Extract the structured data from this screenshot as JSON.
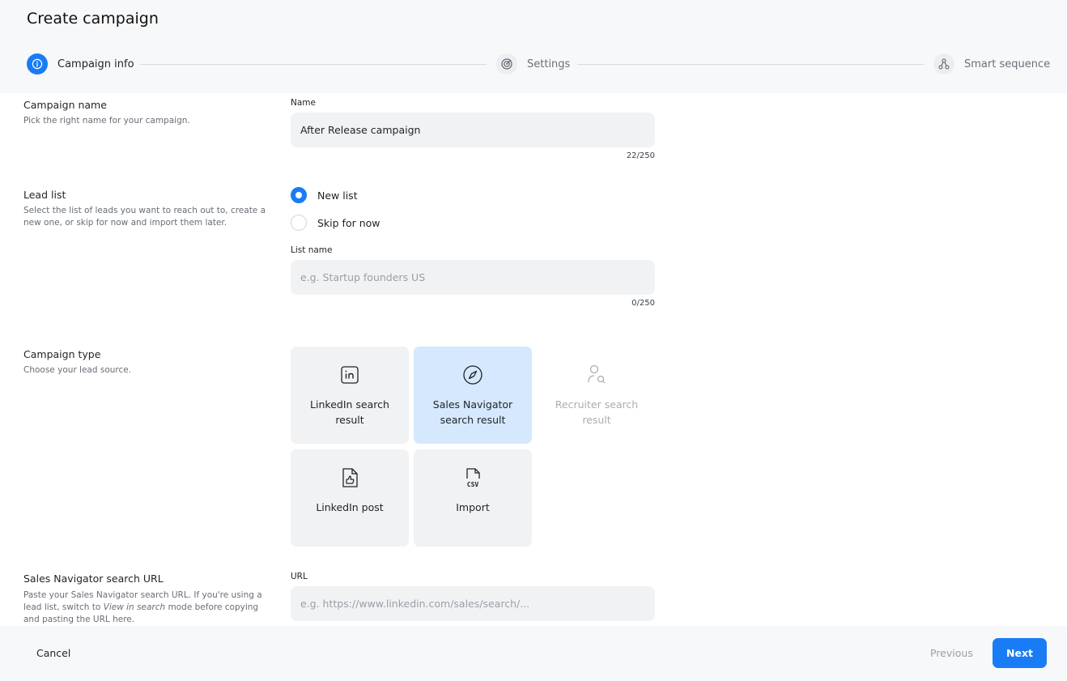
{
  "page": {
    "title": "Create campaign"
  },
  "stepper": {
    "steps": [
      {
        "label": "Campaign info",
        "state": "active",
        "icon": "info-icon"
      },
      {
        "label": "Settings",
        "state": "inactive",
        "icon": "target-icon"
      },
      {
        "label": "Smart sequence",
        "state": "inactive",
        "icon": "sequence-icon"
      }
    ]
  },
  "campaign_name": {
    "title": "Campaign name",
    "description": "Pick the right name for your campaign.",
    "field_label": "Name",
    "value": "After Release campaign",
    "counter": "22/250"
  },
  "lead_list": {
    "title": "Lead list",
    "description": "Select the list of leads you want to reach out to, create a new one, or skip for now and import them later.",
    "options": [
      {
        "label": "New list",
        "checked": true
      },
      {
        "label": "Skip for now",
        "checked": false
      }
    ],
    "list_name_label": "List name",
    "list_name_placeholder": "e.g. Startup founders US",
    "counter": "0/250"
  },
  "campaign_type": {
    "title": "Campaign type",
    "description": "Choose your lead source.",
    "cards": [
      {
        "label": "LinkedIn search result",
        "icon": "linkedin-icon",
        "state": "default"
      },
      {
        "label": "Sales Navigator search result",
        "icon": "compass-icon",
        "state": "selected"
      },
      {
        "label": "Recruiter search result",
        "icon": "user-search-icon",
        "state": "disabled"
      },
      {
        "label": "LinkedIn post",
        "icon": "post-icon",
        "state": "default"
      },
      {
        "label": "Import",
        "icon": "csv-file-icon",
        "state": "default"
      }
    ]
  },
  "sales_nav_url": {
    "title": "Sales Navigator search URL",
    "description_pre": "Paste your Sales Navigator search URL. If you're using a lead list, switch to ",
    "description_em": "View in search",
    "description_post": " mode before copying and pasting the URL here.",
    "field_label": "URL",
    "placeholder": "e.g. https://www.linkedin.com/sales/search/..."
  },
  "footer": {
    "cancel_label": "Cancel",
    "previous_label": "Previous",
    "next_label": "Next"
  },
  "colors": {
    "accent": "#1a7cf5",
    "selected_card": "#d5e8fd",
    "input_bg": "#f1f2f4",
    "header_bg": "#f7f8fa"
  }
}
